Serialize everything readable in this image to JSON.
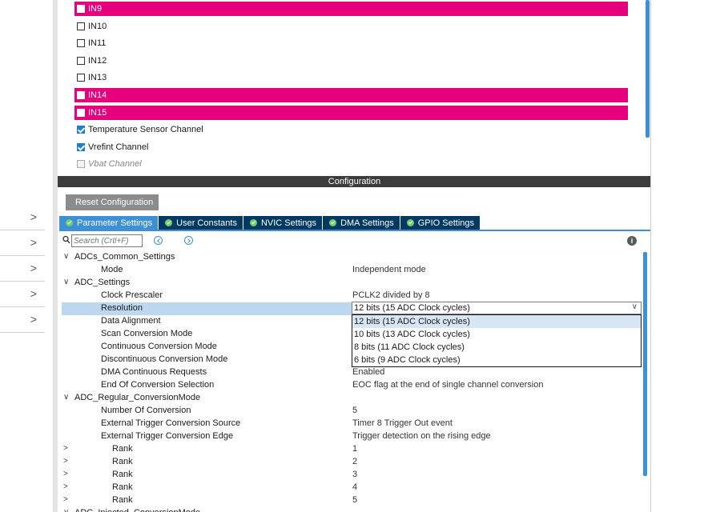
{
  "left_nav": {
    "rows": [
      {
        "chevron": ">"
      },
      {
        "chevron": ">"
      },
      {
        "chevron": ">"
      },
      {
        "chevron": ">"
      },
      {
        "chevron": ">"
      }
    ]
  },
  "channels": [
    {
      "label": "IN9",
      "selected": true,
      "checked": false
    },
    {
      "label": "IN10",
      "selected": false,
      "checked": false
    },
    {
      "label": "IN11",
      "selected": false,
      "checked": false
    },
    {
      "label": "IN12",
      "selected": false,
      "checked": false
    },
    {
      "label": "IN13",
      "selected": false,
      "checked": false
    },
    {
      "label": "IN14",
      "selected": true,
      "checked": false
    },
    {
      "label": "IN15",
      "selected": true,
      "checked": false
    },
    {
      "label": "Temperature Sensor Channel",
      "selected": false,
      "checked": true
    },
    {
      "label": "Vrefint Channel",
      "selected": false,
      "checked": true
    },
    {
      "label": "Vbat Channel",
      "selected": false,
      "checked": false,
      "disabled": true
    }
  ],
  "configuration": {
    "title": "Configuration",
    "reset_label": "Reset Configuration",
    "tabs": [
      {
        "label": "Parameter Settings",
        "active": true
      },
      {
        "label": "User Constants",
        "active": false
      },
      {
        "label": "NVIC Settings",
        "active": false
      },
      {
        "label": "DMA Settings",
        "active": false
      },
      {
        "label": "GPIO Settings",
        "active": false
      }
    ],
    "search_placeholder": "Search (Crtl+F)",
    "info_glyph": "i"
  },
  "params": [
    {
      "kind": "group",
      "toggle": "∨",
      "name": "ADCs_Common_Settings",
      "value": ""
    },
    {
      "kind": "param",
      "name": "Mode",
      "value": "Independent mode"
    },
    {
      "kind": "group",
      "toggle": "∨",
      "name": "ADC_Settings",
      "value": ""
    },
    {
      "kind": "param",
      "name": "Clock Prescaler",
      "value": "PCLK2 divided by 8"
    },
    {
      "kind": "param",
      "name": "Resolution",
      "value": "",
      "highlight": true
    },
    {
      "kind": "param",
      "name": "Data Alignment",
      "value": ""
    },
    {
      "kind": "param",
      "name": "Scan Conversion Mode",
      "value": ""
    },
    {
      "kind": "param",
      "name": "Continuous Conversion Mode",
      "value": ""
    },
    {
      "kind": "param",
      "name": "Discontinuous Conversion Mode",
      "value": ""
    },
    {
      "kind": "param",
      "name": "DMA Continuous Requests",
      "value": "Enabled"
    },
    {
      "kind": "param",
      "name": "End Of Conversion Selection",
      "value": "EOC flag at the end of single channel conversion"
    },
    {
      "kind": "group",
      "toggle": "∨",
      "name": "ADC_Regular_ConversionMode",
      "value": ""
    },
    {
      "kind": "param",
      "name": "Number Of Conversion",
      "value": "5"
    },
    {
      "kind": "param",
      "name": "External Trigger Conversion Source",
      "value": "Timer 8 Trigger Out event"
    },
    {
      "kind": "param",
      "name": "External Trigger Conversion Edge",
      "value": "Trigger detection on the rising edge"
    },
    {
      "kind": "rank",
      "toggle": ">",
      "name": "Rank",
      "value": "1"
    },
    {
      "kind": "rank",
      "toggle": ">",
      "name": "Rank",
      "value": "2"
    },
    {
      "kind": "rank",
      "toggle": ">",
      "name": "Rank",
      "value": "3"
    },
    {
      "kind": "rank",
      "toggle": ">",
      "name": "Rank",
      "value": "4"
    },
    {
      "kind": "rank",
      "toggle": ">",
      "name": "Rank",
      "value": "5"
    },
    {
      "kind": "group",
      "toggle": "∨",
      "name": "ADC_Injected_ConversionMode",
      "value": ""
    }
  ],
  "resolution_select": {
    "value": "12 bits (15 ADC Clock cycles)",
    "chevron": "∨",
    "options": [
      "12 bits (15 ADC Clock cycles)",
      "10 bits (13 ADC Clock cycles)",
      "8 bits (11 ADC Clock cycles)",
      "6 bits (9 ADC Clock cycles)"
    ],
    "hovered_option": 0
  },
  "colors": {
    "selected_channel": "#e6007e",
    "active_tab": "#3d8fd6",
    "tab": "#003a62",
    "header": "#3c3c3c",
    "row_highlight": "#bcd7ee"
  }
}
